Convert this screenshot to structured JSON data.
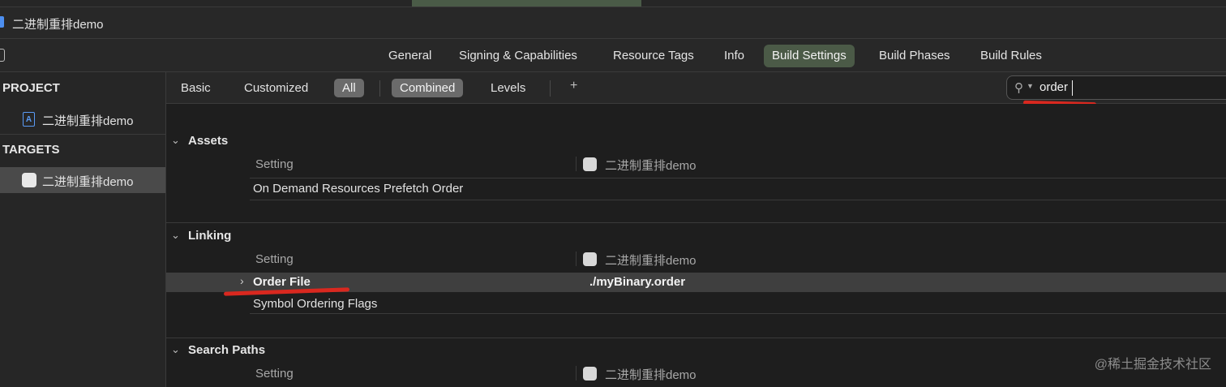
{
  "window": {
    "title": "二进制重排demo"
  },
  "tabs": [
    "General",
    "Signing & Capabilities",
    "Resource Tags",
    "Info",
    "Build Settings",
    "Build Phases",
    "Build Rules"
  ],
  "active_tab": "Build Settings",
  "sidebar": {
    "project_header": "PROJECT",
    "project_item": "二进制重排demo",
    "targets_header": "TARGETS",
    "target_item": "二进制重排demo"
  },
  "filter": {
    "basic": "Basic",
    "customized": "Customized",
    "all": "All",
    "combined": "Combined",
    "levels": "Levels",
    "add": "+",
    "search_value": "order"
  },
  "groups": {
    "assets": {
      "name": "Assets",
      "setting_header": "Setting",
      "target_header": "二进制重排demo",
      "rows": [
        "On Demand Resources Prefetch Order"
      ]
    },
    "linking": {
      "name": "Linking",
      "setting_header": "Setting",
      "target_header": "二进制重排demo",
      "highlighted_row": {
        "name": "Order File",
        "value": "./myBinary.order"
      },
      "rows": [
        "Symbol Ordering Flags"
      ]
    },
    "search_paths": {
      "name": "Search Paths",
      "setting_header": "Setting",
      "target_header": "二进制重排demo"
    }
  },
  "watermark": "@稀土掘金技术社区",
  "colors": {
    "active_tab": "#4b5a47",
    "annotation": "#d9281f",
    "background": "#1e1e1e"
  }
}
